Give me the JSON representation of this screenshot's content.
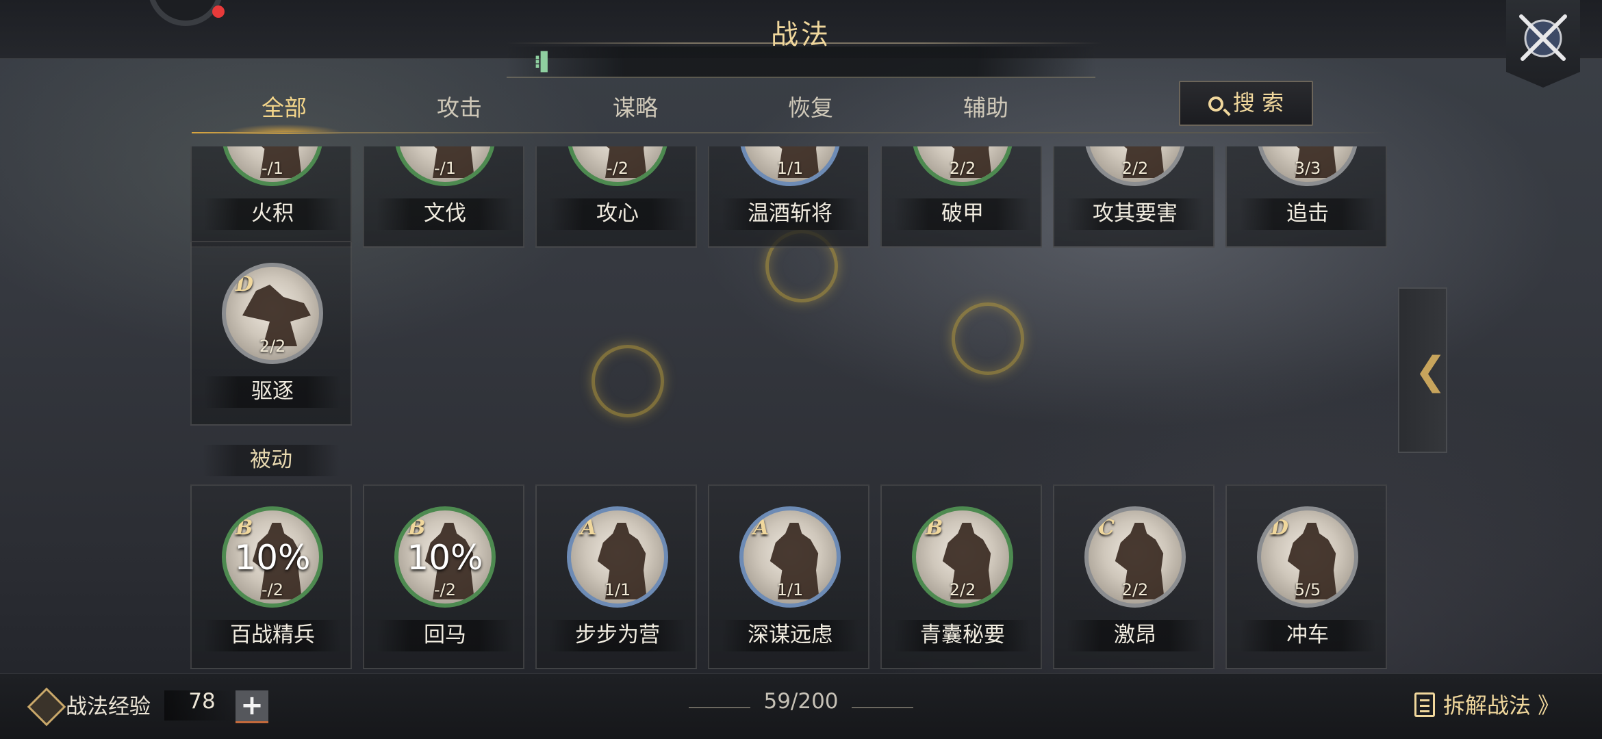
{
  "header": {
    "title": "战法"
  },
  "search_bar": {
    "icon": "input-cursor-icon"
  },
  "tabs": [
    {
      "label": "全部",
      "active": true
    },
    {
      "label": "攻击",
      "active": false
    },
    {
      "label": "谋略",
      "active": false
    },
    {
      "label": "恢复",
      "active": false
    },
    {
      "label": "辅助",
      "active": false
    }
  ],
  "search_button": {
    "label": "搜 索"
  },
  "active_row": [
    {
      "name": "火积",
      "count": "-/1",
      "ring": "green"
    },
    {
      "name": "文伐",
      "count": "-/1",
      "ring": "green"
    },
    {
      "name": "攻心",
      "count": "-/2",
      "ring": "green"
    },
    {
      "name": "温酒斩将",
      "count": "1/1",
      "ring": "blue"
    },
    {
      "name": "破甲",
      "count": "2/2",
      "ring": "green"
    },
    {
      "name": "攻其要害",
      "count": "2/2",
      "ring": "grey"
    },
    {
      "name": "追击",
      "count": "3/3",
      "ring": "grey"
    }
  ],
  "single_card": {
    "name": "驱逐",
    "grade": "D",
    "count": "2/2",
    "ring": "grey"
  },
  "passive_section": {
    "label": "被动"
  },
  "passive_row": [
    {
      "name": "百战精兵",
      "grade": "B",
      "percent": "10%",
      "count": "-/2",
      "ring": "green"
    },
    {
      "name": "回马",
      "grade": "B",
      "percent": "10%",
      "count": "-/2",
      "ring": "green"
    },
    {
      "name": "步步为营",
      "grade": "A",
      "percent": "",
      "count": "1/1",
      "ring": "blue"
    },
    {
      "name": "深谋远虑",
      "grade": "A",
      "percent": "",
      "count": "1/1",
      "ring": "blue"
    },
    {
      "name": "青囊秘要",
      "grade": "B",
      "percent": "",
      "count": "2/2",
      "ring": "green"
    },
    {
      "name": "激昂",
      "grade": "C",
      "percent": "",
      "count": "2/2",
      "ring": "grey"
    },
    {
      "name": "冲车",
      "grade": "D",
      "percent": "",
      "count": "5/5",
      "ring": "grey"
    }
  ],
  "side_handle": {
    "glyph": "❮"
  },
  "footer": {
    "exp_label": "战法经验",
    "exp_value": "78",
    "plus": "+",
    "capacity": "59/200",
    "dismantle_label": "拆解战法 》"
  }
}
